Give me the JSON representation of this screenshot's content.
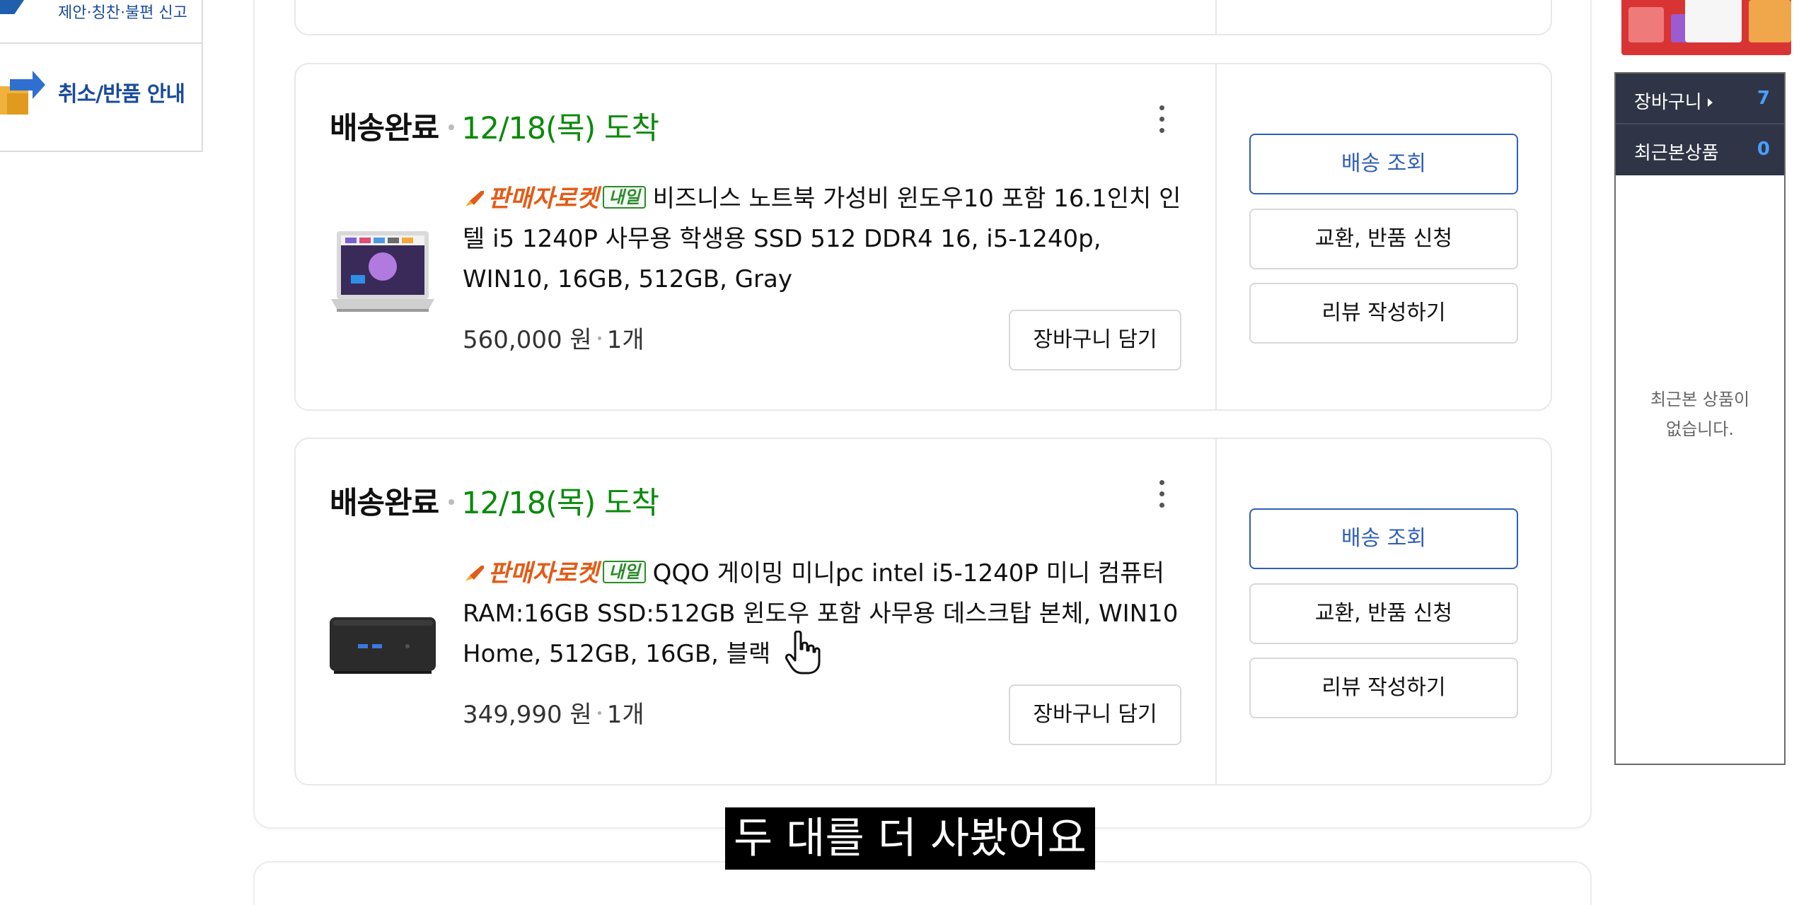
{
  "left_menu": {
    "items": [
      {
        "label": "제안·칭찬·불편 신고",
        "icon": "megaphone-icon"
      },
      {
        "label": "취소/반품 안내",
        "icon": "swap-arrows-icon"
      }
    ]
  },
  "orders": [
    {
      "status": "배송완료",
      "arrival": "12/18(목) 도착",
      "badge_rocket": "판매자로켓",
      "badge_tomorrow": "내일",
      "title": "비즈니스 노트북 가성비 윈도우10 포함 16.1인치 인텔 i5 1240P 사무용 학생용 SSD 512 DDR4 16, i5-1240p, WIN10, 16GB, 512GB, Gray",
      "price": "560,000 원",
      "quantity": "1개",
      "thumbnail": "laptop-thumbnail",
      "cart_button": "장바구니 담기",
      "actions": {
        "track": "배송 조회",
        "exchange": "교환, 반품 신청",
        "review": "리뷰 작성하기"
      }
    },
    {
      "status": "배송완료",
      "arrival": "12/18(목) 도착",
      "badge_rocket": "판매자로켓",
      "badge_tomorrow": "내일",
      "title": "QQO 게이밍 미니pc intel i5-1240P 미니 컴퓨터 RAM:16GB SSD:512GB 윈도우 포함 사무용 데스크탑 본체, WIN10 Home, 512GB, 16GB, 블랙",
      "price": "349,990 원",
      "quantity": "1개",
      "thumbnail": "mini-pc-thumbnail",
      "cart_button": "장바구니 담기",
      "actions": {
        "track": "배송 조회",
        "exchange": "교환, 반품 신청",
        "review": "리뷰 작성하기"
      }
    }
  ],
  "side_panel": {
    "cart_label": "장바구니",
    "cart_count": "7",
    "recent_label": "최근본상품",
    "recent_count": "0",
    "empty_message_1": "최근본 상품이",
    "empty_message_2": "없습니다."
  },
  "caption": "두 대를 더 사봤어요",
  "colors": {
    "arrival_green": "#0b8a0b",
    "rocket_orange": "#e35b16",
    "track_blue": "#2f5fb8",
    "side_dark": "#2f3546",
    "count_blue": "#4a9eff"
  }
}
